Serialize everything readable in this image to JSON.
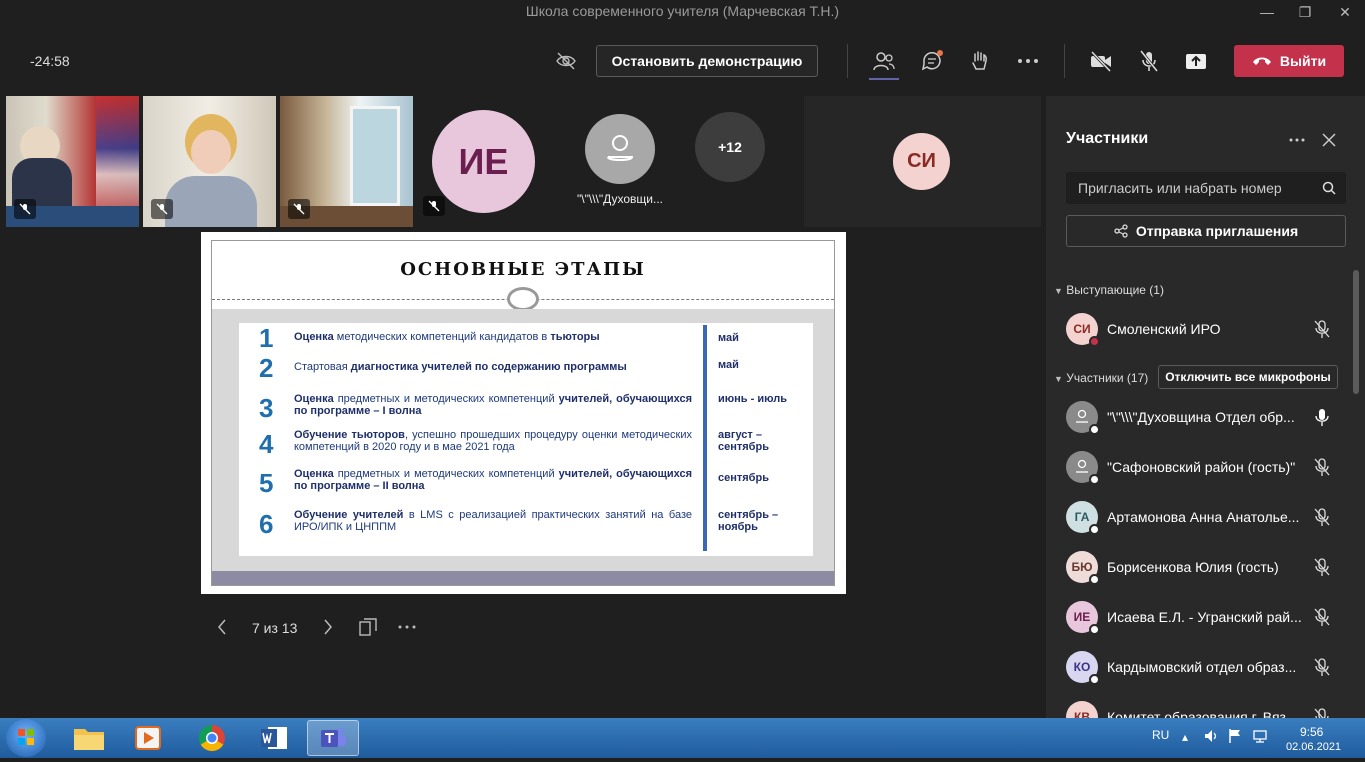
{
  "window": {
    "title": "Школа современного учителя (Марчевская Т.Н.)"
  },
  "toolbar": {
    "timer": "-24:58",
    "stop_share_label": "Остановить демонстрацию",
    "leave_label": "Выйти"
  },
  "stage": {
    "tiles": [
      {
        "type": "avatar",
        "initials": "ИЕ",
        "bg": "#e8c7dd",
        "fg": "#6b1f4e"
      },
      {
        "type": "avatar",
        "name": "\"\\\"\\\\\\\"Духовщи...",
        "bg": "#a8a8a8"
      },
      {
        "type": "overflow",
        "label": "+12"
      },
      {
        "type": "avatar",
        "initials": "СИ",
        "bg": "#f3d2cf",
        "fg": "#8a2a24"
      }
    ],
    "slide": {
      "title": "ОСНОВНЫЕ ЭТАПЫ",
      "steps": [
        {
          "n": "1",
          "bold1": "Оценка",
          "text": " методических компетенций кандидатов в ",
          "bold2": "тьюторы",
          "rest": "",
          "when": "май"
        },
        {
          "n": "2",
          "bold1": "",
          "text": "Стартовая ",
          "bold2": "диагностика учителей по содержанию программы",
          "rest": "",
          "when": "май"
        },
        {
          "n": "3",
          "bold1": "Оценка",
          "text": " предметных и методических компетенций ",
          "bold2": "учителей,",
          "rest": " обучающихся по программе – I волна",
          "when": "июнь - июль"
        },
        {
          "n": "4",
          "bold1": "Обучение тьюторов",
          "text": ", успешно прошедших процедуру оценки методических компетенций в 2020 году и в мае 2021 года",
          "bold2": "",
          "rest": "",
          "when": "август – сентябрь"
        },
        {
          "n": "5",
          "bold1": "Оценка",
          "text": " предметных и методических компетенций ",
          "bold2": "учителей,",
          "rest": " обучающихся по программе – II волна",
          "when": "сентябрь"
        },
        {
          "n": "6",
          "bold1": "Обучение учителей",
          "text": " в LMS с реализацией практических занятий на базе ИРО/ИПК и ЦНППМ",
          "bold2": "",
          "rest": "",
          "when": "сентябрь – ноябрь"
        }
      ]
    },
    "slide_counter": "7 из 13"
  },
  "panel": {
    "title": "Участники",
    "invite_placeholder": "Пригласить или набрать номер",
    "send_invite_label": "Отправка приглашения",
    "presenters_header": "Выступающие (1)",
    "participants_header": "Участники (17)",
    "mute_all_label": "Отключить все микрофоны",
    "presenters": [
      {
        "initials": "СИ",
        "name": "Смоленский ИРО",
        "bg": "#f3d2cf",
        "fg": "#8a2a24",
        "status": "#c4314b"
      }
    ],
    "participants": [
      {
        "initials": "",
        "name": "\"\\\"\\\\\\\"Духовщина Отдел обр...",
        "bg": "#8a8a8a",
        "fg": "#fff",
        "mic": "on"
      },
      {
        "initials": "",
        "name": "\"Сафоновский район (гость)\"",
        "bg": "#8a8a8a",
        "fg": "#fff",
        "mic": "off"
      },
      {
        "initials": "ГА",
        "name": "Артамонова Анна Анатолье...",
        "bg": "#cfe0e3",
        "fg": "#2d5b63",
        "mic": "off"
      },
      {
        "initials": "БЮ",
        "name": "Борисенкова Юлия (гость)",
        "bg": "#efdcd9",
        "fg": "#6a3b33",
        "mic": "off"
      },
      {
        "initials": "ИЕ",
        "name": "Исаева Е.Л. - Угранский рай...",
        "bg": "#e8c7dd",
        "fg": "#6b1f4e",
        "mic": "off"
      },
      {
        "initials": "КО",
        "name": "Кардымовский отдел образ...",
        "bg": "#d9d6f1",
        "fg": "#3a3485",
        "mic": "off"
      },
      {
        "initials": "КВ",
        "name": "Комитет образования г. Вяз...",
        "bg": "#f3d2cf",
        "fg": "#8a2a24",
        "mic": "off"
      }
    ]
  },
  "taskbar": {
    "lang": "RU",
    "time": "9:56",
    "date": "02.06.2021"
  }
}
